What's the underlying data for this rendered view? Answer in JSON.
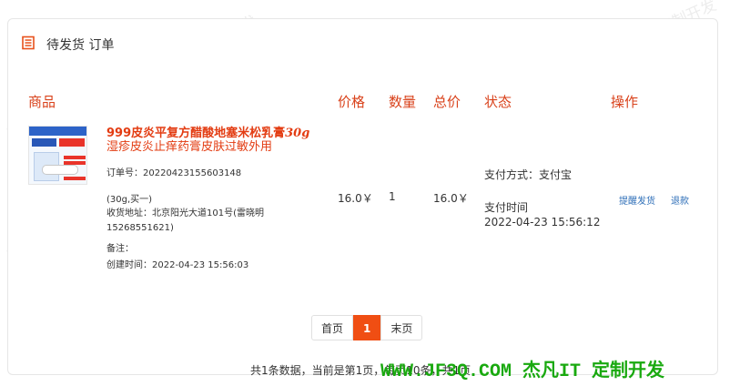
{
  "card": {
    "title": "待发货 订单",
    "icon": "order-list-icon",
    "icon_color": "#e8511c"
  },
  "table": {
    "headers": {
      "goods": "商品",
      "price": "价格",
      "qty": "数量",
      "total": "总价",
      "status": "状态",
      "action": "操作"
    },
    "header_color": "#d9421b"
  },
  "order": {
    "product_name_prefix": "999皮炎平复方醋酸地塞米松乳膏",
    "product_name_em": "30g",
    "product_name_line2": "湿疹皮炎止痒药膏皮肤过敏外用",
    "order_no": "订单号：20220423155603148",
    "spec": "(30g,买一)",
    "address": "收货地址：北京阳光大道101号(雷晓明15268551621)",
    "note": "备注：",
    "created": "创建时间：2022-04-23 15:56:03",
    "price": "16.0￥",
    "qty": "1",
    "total": "16.0￥",
    "pay_method": "支付方式：支付宝",
    "pay_time_label": "支付时间",
    "pay_time": "2022-04-23 15:56:12",
    "actions": {
      "remind": "提醒发货",
      "refund": "退款"
    }
  },
  "pagination": {
    "first": "首页",
    "current": "1",
    "last": "末页",
    "accent": "#f04e13"
  },
  "summary": "共1条数据，当前是第1页，每页10条，共1页",
  "watermarks": {
    "jf": "WWW.JF3Q.COM",
    "brand": "杰凡IT",
    "custom": "定制开发",
    "jf_brand": "WWW.JF3Q.COM 杰凡IT",
    "footer": "WWW.JF3Q.COM 杰凡IT  定制开发",
    "footer_color": "#19a90f"
  }
}
